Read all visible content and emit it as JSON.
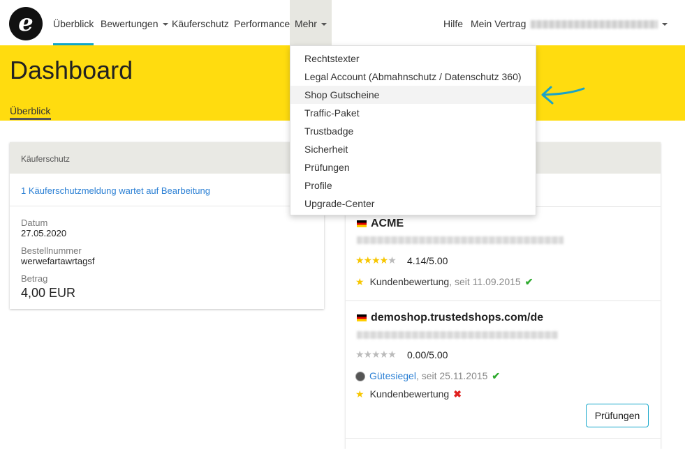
{
  "nav": {
    "logo_letter": "e",
    "items": [
      "Überblick",
      "Bewertungen",
      "Käuferschutz",
      "Performance",
      "Mehr"
    ],
    "right": [
      "Hilfe",
      "Mein Vertrag"
    ]
  },
  "header": {
    "title": "Dashboard",
    "subtab": "Überblick"
  },
  "dropdown": {
    "items": [
      "Rechtstexter",
      "Legal Account (Abmahnschutz / Datenschutz 360)",
      "Shop Gutscheine",
      "Traffic-Paket",
      "Trustbadge",
      "Sicherheit",
      "Prüfungen",
      "Profile",
      "Upgrade-Center"
    ],
    "highlighted": "Shop Gutscheine"
  },
  "kaeuferschutz": {
    "title": "Käuferschutz",
    "link": "1 Käuferschutzmeldung wartet auf Bearbeitung",
    "datum_label": "Datum",
    "datum_value": "27.05.2020",
    "bestell_label": "Bestellnummer",
    "bestell_value": "werwefartawrtagsf",
    "betrag_label": "Betrag",
    "betrag_value": "4,00 EUR"
  },
  "shops": [
    {
      "name": "ACME",
      "stars_filled": 4,
      "rating": "4.14/5.00",
      "kundenbewertung": "Kundenbewertung",
      "since": ", seit 11.09.2015"
    },
    {
      "name": "demoshop.trustedshops.com/de",
      "stars_filled": 0,
      "rating": "0.00/5.00",
      "guetesiegel": "Gütesiegel",
      "guetesiegel_since": ", seit 25.11.2015",
      "kundenbewertung": "Kundenbewertung",
      "button": "Prüfungen"
    }
  ],
  "colors": {
    "brand_yellow": "#ffdc0f",
    "accent_teal": "#11a5c9",
    "link_blue": "#2a7fd4",
    "check_green": "#2eaa2e",
    "cross_red": "#e0201e"
  }
}
